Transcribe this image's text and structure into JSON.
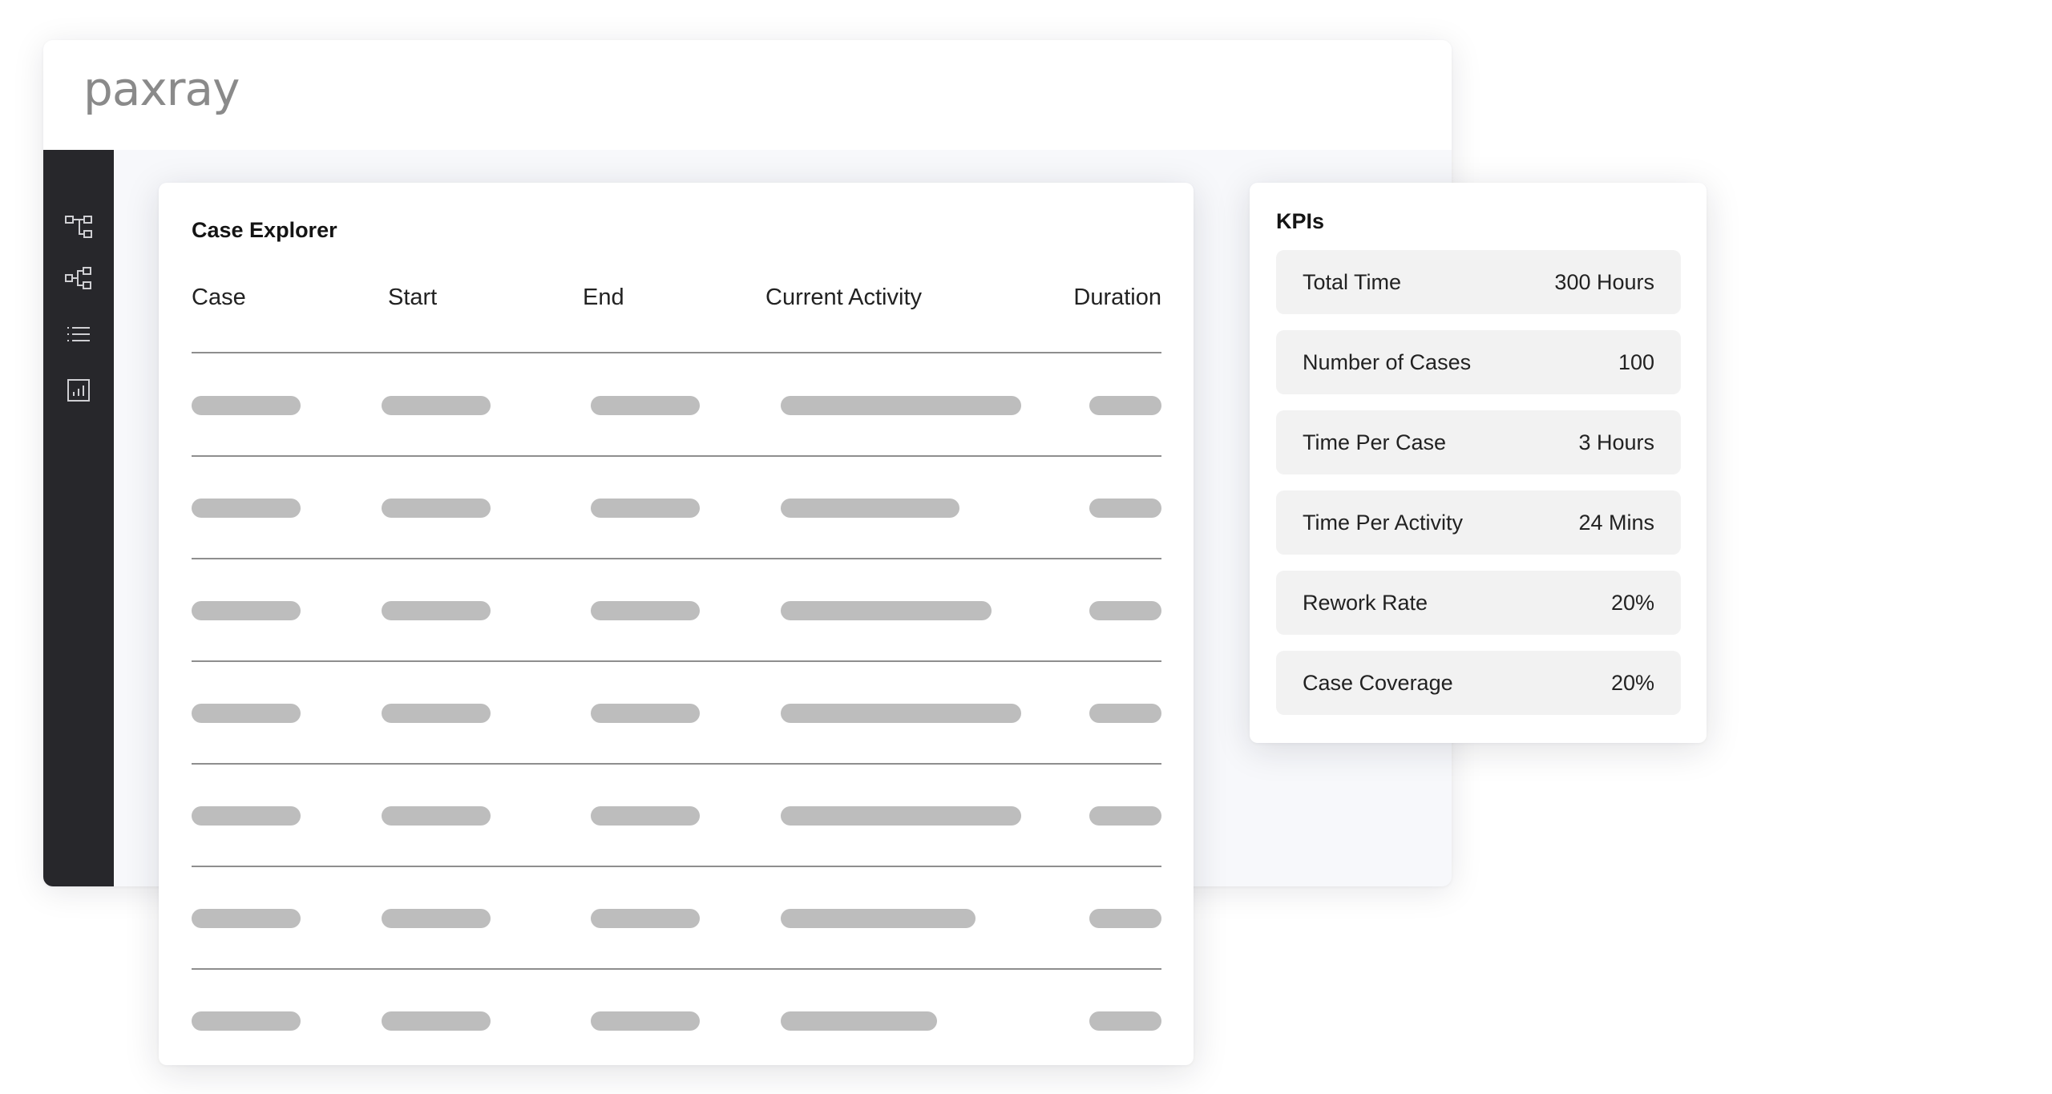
{
  "app": {
    "logo_text": "paxray"
  },
  "sidebar": {
    "items": [
      {
        "icon": "process-map-icon"
      },
      {
        "icon": "variant-tree-icon"
      },
      {
        "icon": "list-icon"
      },
      {
        "icon": "report-chart-icon"
      }
    ]
  },
  "case_explorer": {
    "title": "Case Explorer",
    "columns": [
      "Case",
      "Start",
      "End",
      "Current Activity",
      "Duration"
    ],
    "rows_loading": 7
  },
  "kpis": {
    "title": "KPIs",
    "items": [
      {
        "label": "Total Time",
        "value": "300 Hours"
      },
      {
        "label": "Number of Cases",
        "value": "100"
      },
      {
        "label": "Time Per Case",
        "value": "3 Hours"
      },
      {
        "label": "Time Per Activity",
        "value": "24 Mins"
      },
      {
        "label": "Rework Rate",
        "value": "20%"
      },
      {
        "label": "Case Coverage",
        "value": "20%"
      }
    ]
  },
  "colors": {
    "sidebar_bg": "#27272b",
    "skeleton": "#bdbdbd",
    "kpi_row_bg": "#f2f2f2",
    "logo": "#8a8a8a"
  }
}
